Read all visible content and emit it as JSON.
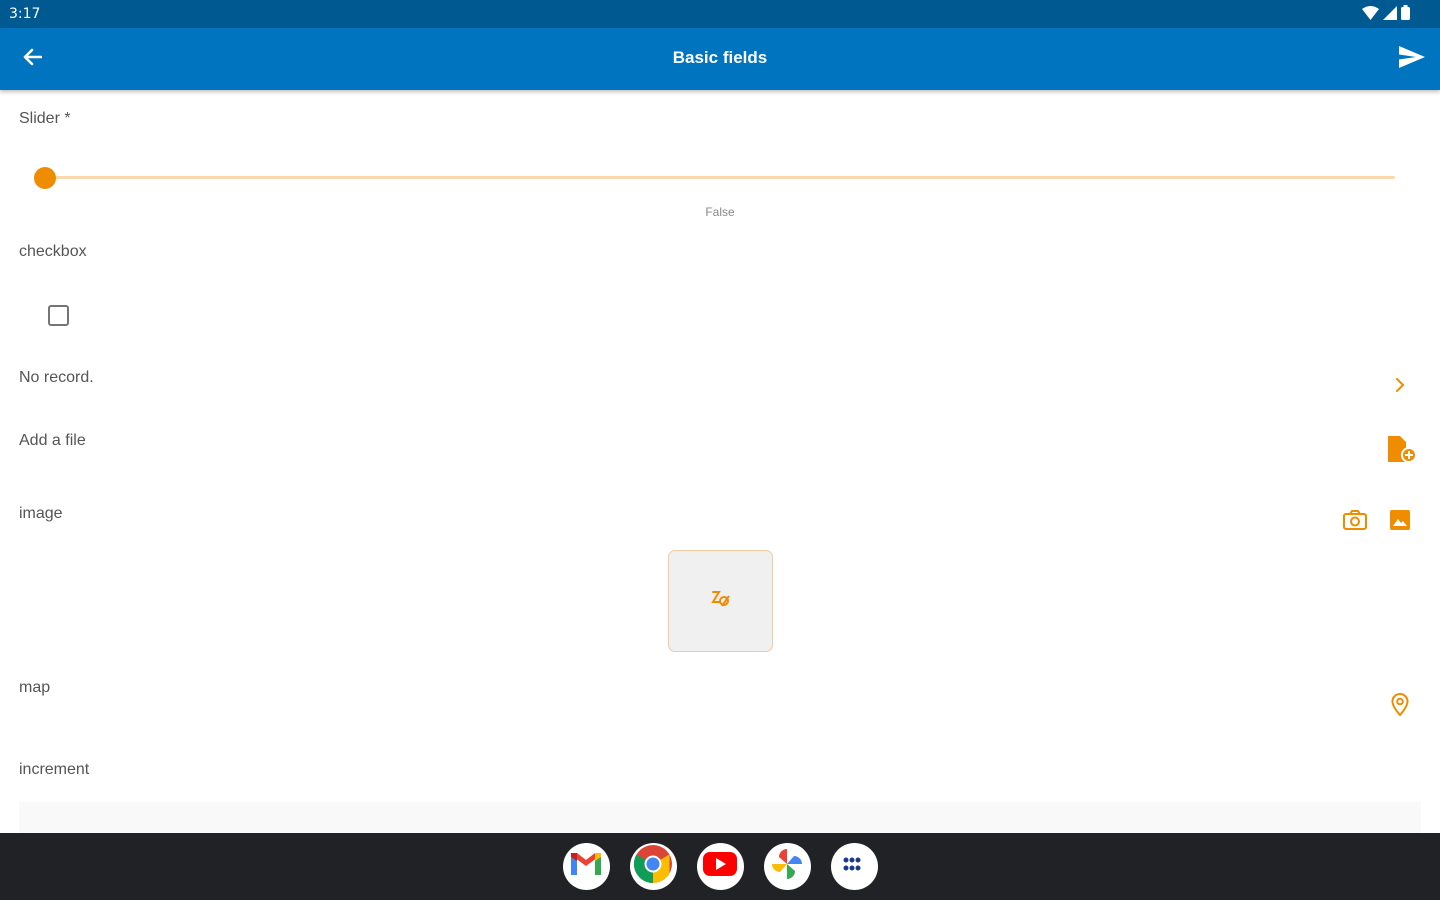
{
  "status_bar": {
    "time": "3:17",
    "icons": [
      "wifi-icon",
      "signal-icon",
      "battery-icon"
    ]
  },
  "app_bar": {
    "title": "Basic fields",
    "back_icon": "arrow-back-icon",
    "send_icon": "send-icon",
    "background": "#0074bf"
  },
  "form": {
    "slider": {
      "label": "Slider *",
      "value_text": "False",
      "level": 0
    },
    "checkbox": {
      "label": "checkbox",
      "checked": false
    },
    "record": {
      "label": "No record.",
      "icon": "chevron-right-icon"
    },
    "file": {
      "label": "Add a file",
      "icon": "file-add-icon"
    },
    "image": {
      "label": "image",
      "camera_icon": "camera-icon",
      "gallery_icon": "image-icon",
      "placeholder_icon": "image-placeholder-icon"
    },
    "map": {
      "label": "map",
      "icon": "location-pin-icon"
    },
    "increment": {
      "label": "increment"
    }
  },
  "dock": [
    "gmail-icon",
    "chrome-icon",
    "youtube-icon",
    "photos-icon",
    "app-drawer-icon"
  ],
  "colors": {
    "accent": "#f08c00",
    "status_bar": "#005a92",
    "nav_bar": "#212225"
  }
}
